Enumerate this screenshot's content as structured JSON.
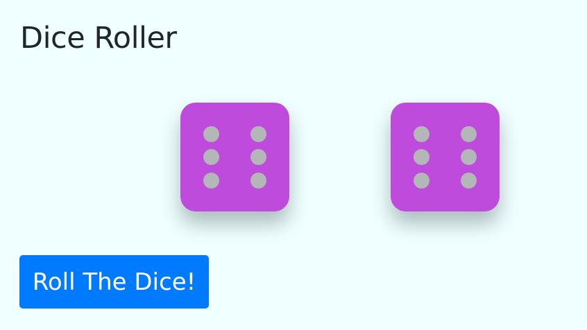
{
  "header": {
    "title": "Dice Roller"
  },
  "dice": [
    {
      "value": 6,
      "face_color": "#bf4bdc",
      "pip_color": "#b3b7b7"
    },
    {
      "value": 6,
      "face_color": "#bf4bdc",
      "pip_color": "#b3b7b7"
    }
  ],
  "actions": {
    "roll_label": "Roll The Dice!",
    "roll_color": "#007bff"
  },
  "colors": {
    "background": "#f0ffff"
  }
}
